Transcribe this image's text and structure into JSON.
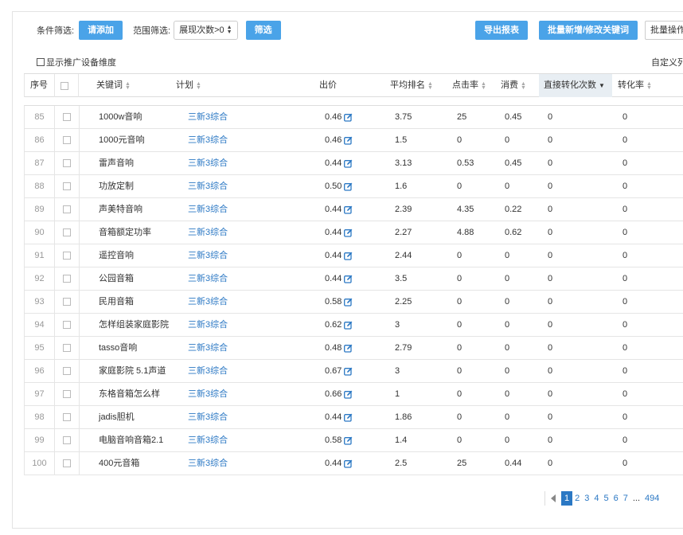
{
  "toolbar": {
    "filter_label": "条件筛选:",
    "add_label": "请添加",
    "range_label": "范围筛选:",
    "range_value": "展现次数>0",
    "filter_btn": "筛选",
    "export_btn": "导出报表",
    "batch_btn": "批量新增/修改关键词",
    "batch2_btn": "批量操作"
  },
  "options": {
    "show_device": "显示推广设备维度",
    "custom": "自定义列"
  },
  "columns": {
    "seq": "序号",
    "keyword": "关键词",
    "plan": "计划",
    "bid": "出价",
    "rank": "平均排名",
    "ctr": "点击率",
    "cost": "消费",
    "conv": "直接转化次数",
    "rate": "转化率"
  },
  "rows": [
    {
      "seq": "85",
      "keyword": "1000w音响",
      "plan": "三新3综合",
      "bid": "0.46",
      "rank": "3.75",
      "ctr": "25",
      "cost": "0.45",
      "conv": "0",
      "rate": "0"
    },
    {
      "seq": "86",
      "keyword": "1000元音响",
      "plan": "三新3综合",
      "bid": "0.46",
      "rank": "1.5",
      "ctr": "0",
      "cost": "0",
      "conv": "0",
      "rate": "0"
    },
    {
      "seq": "87",
      "keyword": "雷声音响",
      "plan": "三新3综合",
      "bid": "0.44",
      "rank": "3.13",
      "ctr": "0.53",
      "cost": "0.45",
      "conv": "0",
      "rate": "0"
    },
    {
      "seq": "88",
      "keyword": "功放定制",
      "plan": "三新3综合",
      "bid": "0.50",
      "rank": "1.6",
      "ctr": "0",
      "cost": "0",
      "conv": "0",
      "rate": "0"
    },
    {
      "seq": "89",
      "keyword": "声美特音响",
      "plan": "三新3综合",
      "bid": "0.44",
      "rank": "2.39",
      "ctr": "4.35",
      "cost": "0.22",
      "conv": "0",
      "rate": "0"
    },
    {
      "seq": "90",
      "keyword": "音箱额定功率",
      "plan": "三新3综合",
      "bid": "0.44",
      "rank": "2.27",
      "ctr": "4.88",
      "cost": "0.62",
      "conv": "0",
      "rate": "0"
    },
    {
      "seq": "91",
      "keyword": "遥控音响",
      "plan": "三新3综合",
      "bid": "0.44",
      "rank": "2.44",
      "ctr": "0",
      "cost": "0",
      "conv": "0",
      "rate": "0"
    },
    {
      "seq": "92",
      "keyword": "公园音箱",
      "plan": "三新3综合",
      "bid": "0.44",
      "rank": "3.5",
      "ctr": "0",
      "cost": "0",
      "conv": "0",
      "rate": "0"
    },
    {
      "seq": "93",
      "keyword": "民用音箱",
      "plan": "三新3综合",
      "bid": "0.58",
      "rank": "2.25",
      "ctr": "0",
      "cost": "0",
      "conv": "0",
      "rate": "0"
    },
    {
      "seq": "94",
      "keyword": "怎样组装家庭影院",
      "plan": "三新3综合",
      "bid": "0.62",
      "rank": "3",
      "ctr": "0",
      "cost": "0",
      "conv": "0",
      "rate": "0"
    },
    {
      "seq": "95",
      "keyword": "tasso音响",
      "plan": "三新3综合",
      "bid": "0.48",
      "rank": "2.79",
      "ctr": "0",
      "cost": "0",
      "conv": "0",
      "rate": "0"
    },
    {
      "seq": "96",
      "keyword": "家庭影院 5.1声道",
      "plan": "三新3综合",
      "bid": "0.67",
      "rank": "3",
      "ctr": "0",
      "cost": "0",
      "conv": "0",
      "rate": "0"
    },
    {
      "seq": "97",
      "keyword": "东格音箱怎么样",
      "plan": "三新3综合",
      "bid": "0.66",
      "rank": "1",
      "ctr": "0",
      "cost": "0",
      "conv": "0",
      "rate": "0"
    },
    {
      "seq": "98",
      "keyword": "jadis胆机",
      "plan": "三新3综合",
      "bid": "0.44",
      "rank": "1.86",
      "ctr": "0",
      "cost": "0",
      "conv": "0",
      "rate": "0"
    },
    {
      "seq": "99",
      "keyword": "电脑音响音箱2.1",
      "plan": "三新3综合",
      "bid": "0.58",
      "rank": "1.4",
      "ctr": "0",
      "cost": "0",
      "conv": "0",
      "rate": "0"
    },
    {
      "seq": "100",
      "keyword": "400元音箱",
      "plan": "三新3综合",
      "bid": "0.44",
      "rank": "2.5",
      "ctr": "25",
      "cost": "0.44",
      "conv": "0",
      "rate": "0"
    }
  ],
  "pager": {
    "pages": [
      "1",
      "2",
      "3",
      "4",
      "5",
      "6",
      "7"
    ],
    "ellipsis": "...",
    "last": "494",
    "current": "1"
  },
  "colors": {
    "accent": "#4aa3e8",
    "link": "#2b78c4"
  }
}
